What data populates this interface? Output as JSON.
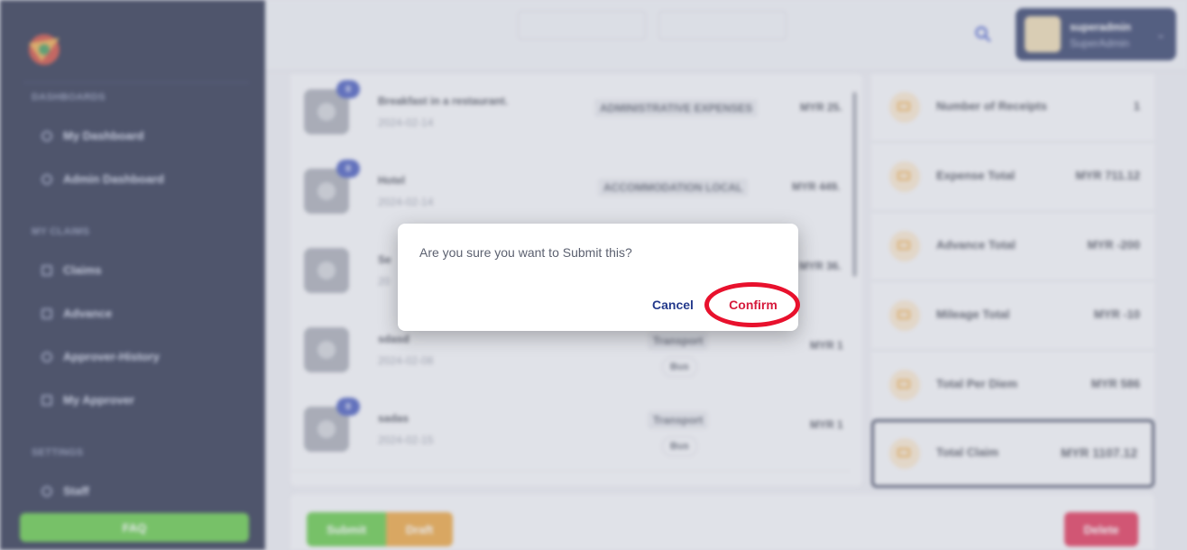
{
  "sidebar": {
    "sections": [
      "DASHBOARDS",
      "MY CLAIMS",
      "SETTINGS"
    ],
    "items": [
      {
        "label": "My Dashboard"
      },
      {
        "label": "Admin Dashboard"
      },
      {
        "label": "Claims"
      },
      {
        "label": "Advance"
      },
      {
        "label": "Approver-History"
      },
      {
        "label": "My Approver"
      },
      {
        "label": "Staff"
      }
    ],
    "faq_label": "FAQ"
  },
  "user": {
    "name": "superadmin",
    "role": "SuperAdmin"
  },
  "list": {
    "rows": [
      {
        "badge": "0",
        "title": "Breakfast in a restaurant.",
        "date": "2024-02-14",
        "category": "ADMINISTRATIVE EXPENSES",
        "subcategory": "",
        "amount": "MYR 25."
      },
      {
        "badge": "0",
        "title": "Hotel",
        "date": "2024-02-14",
        "category": "ACCOMMODATION LOCAL",
        "subcategory": "",
        "amount": "MYR 449."
      },
      {
        "badge": "",
        "title": "Se",
        "date": "20",
        "category": "",
        "subcategory": "",
        "amount": "MYR 36."
      },
      {
        "badge": "",
        "title": "sdasd",
        "date": "2024-02-08",
        "category": "Transport",
        "subcategory": "Bus",
        "amount": "MYR 1"
      },
      {
        "badge": "0",
        "title": "sadas",
        "date": "2024-02-15",
        "category": "Transport",
        "subcategory": "Bus",
        "amount": "MYR 1"
      }
    ]
  },
  "summary": [
    {
      "label": "Number of Receipts",
      "value": "1"
    },
    {
      "label": "Expense Total",
      "value": "MYR 711.12"
    },
    {
      "label": "Advance Total",
      "value": "MYR -200"
    },
    {
      "label": "Mileage Total",
      "value": "MYR -10"
    },
    {
      "label": "Total Per Diem",
      "value": "MYR 586"
    },
    {
      "label": "Total Claim",
      "value": "MYR 1107.12"
    }
  ],
  "actions": {
    "submit": "Submit",
    "draft": "Draft",
    "delete": "Delete"
  },
  "colors": {
    "sidebar": "#141c3a",
    "submit": "#52c234",
    "draft": "#e89a2a",
    "delete": "#dc1e45",
    "confirm": "#d61a3c",
    "cancel": "#243a8c",
    "highlight_ring": "#e8112d"
  },
  "dialog": {
    "message": "Are you sure you want to Submit this?",
    "cancel_label": "Cancel",
    "confirm_label": "Confirm"
  }
}
